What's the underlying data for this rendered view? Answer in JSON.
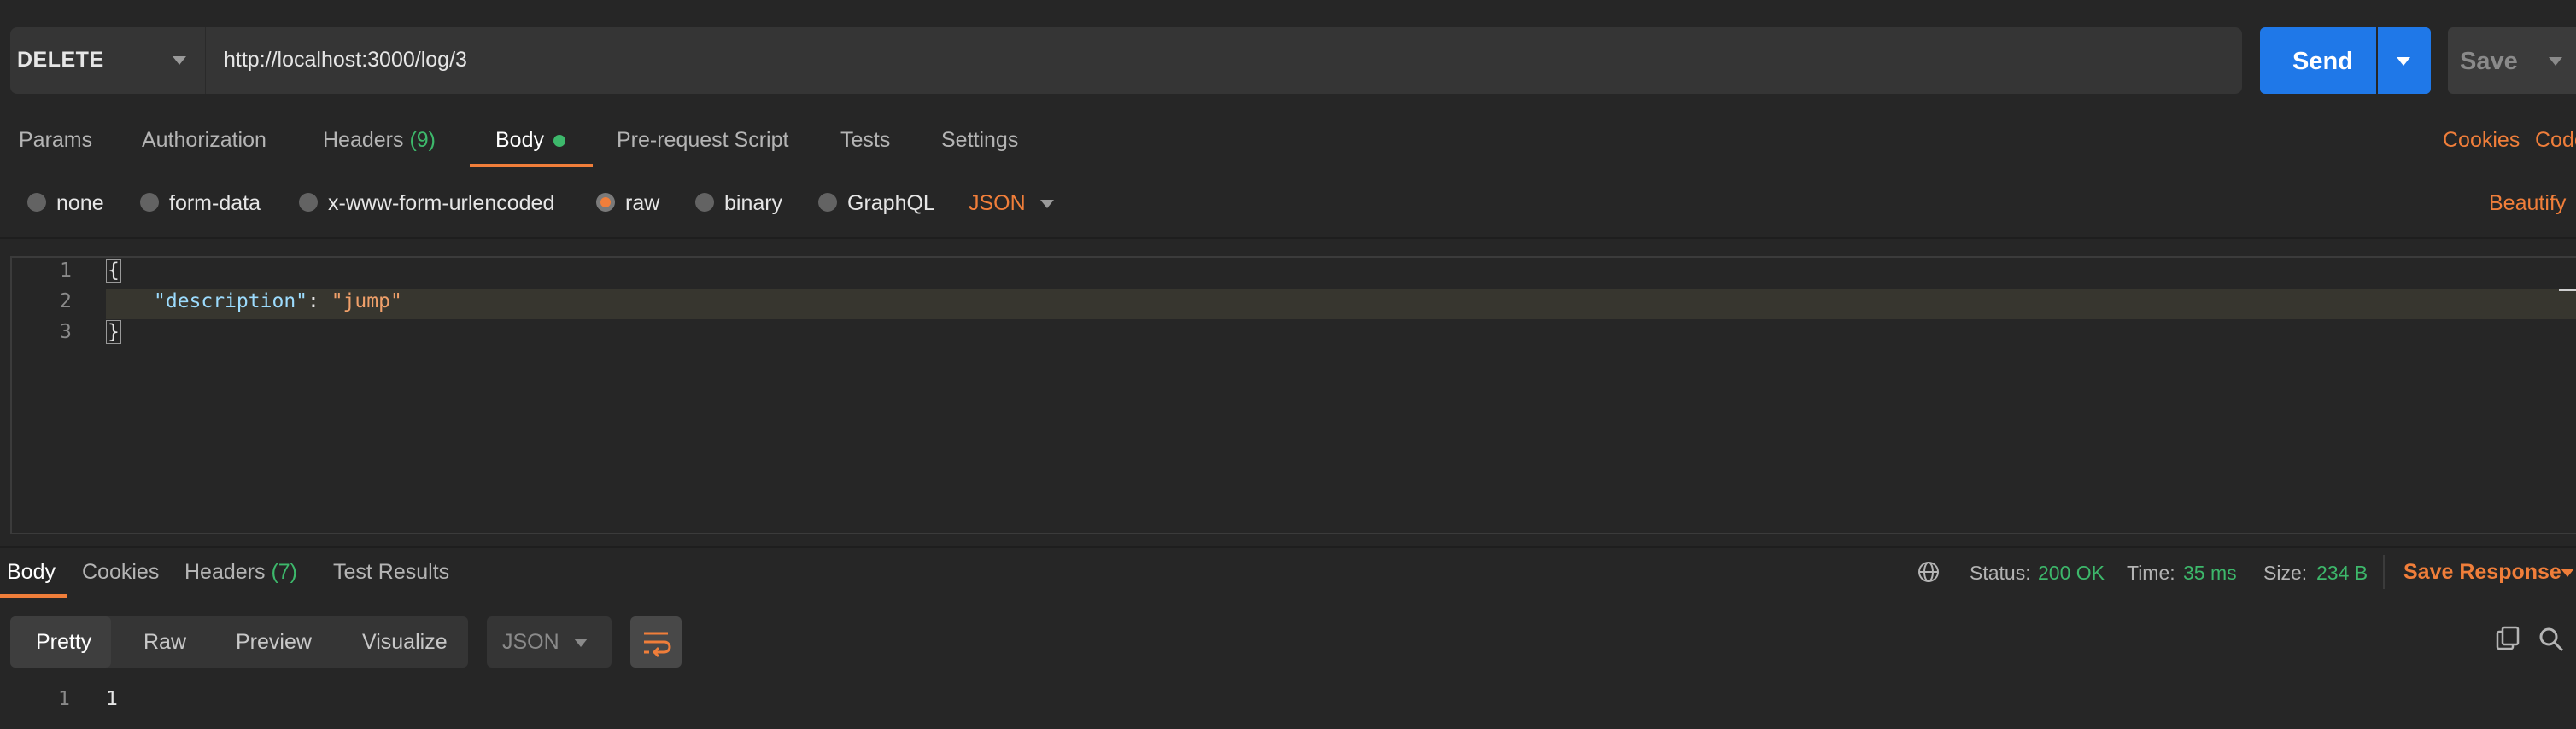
{
  "request": {
    "method": "DELETE",
    "url": "http://localhost:3000/log/3",
    "send_label": "Send",
    "save_label": "Save"
  },
  "request_tabs": [
    {
      "label": "Params"
    },
    {
      "label": "Authorization"
    },
    {
      "label": "Headers",
      "count": "(9)"
    },
    {
      "label": "Body",
      "active": true
    },
    {
      "label": "Pre-request Script"
    },
    {
      "label": "Tests"
    },
    {
      "label": "Settings"
    }
  ],
  "right_links": {
    "cookies": "Cookies",
    "code": "Code"
  },
  "body_types": [
    {
      "label": "none"
    },
    {
      "label": "form-data"
    },
    {
      "label": "x-www-form-urlencoded"
    },
    {
      "label": "raw",
      "selected": true
    },
    {
      "label": "binary"
    },
    {
      "label": "GraphQL"
    }
  ],
  "raw_format": "JSON",
  "beautify_label": "Beautify",
  "editor": {
    "line_numbers": [
      "1",
      "2",
      "3"
    ],
    "open_brace": "{",
    "key": "\"description\"",
    "colon": ": ",
    "value": "\"jump\"",
    "close_brace": "}"
  },
  "response_tabs": [
    {
      "label": "Body",
      "active": true
    },
    {
      "label": "Cookies"
    },
    {
      "label": "Headers",
      "count": "(7)"
    },
    {
      "label": "Test Results"
    }
  ],
  "status": {
    "status_label": "Status:",
    "status_value": "200 OK",
    "time_label": "Time:",
    "time_value": "35 ms",
    "size_label": "Size:",
    "size_value": "234 B"
  },
  "save_response_label": "Save Response",
  "view_modes": [
    "Pretty",
    "Raw",
    "Preview",
    "Visualize"
  ],
  "response_format": "JSON",
  "response_body": {
    "line_number": "1",
    "value": "1"
  },
  "colors": {
    "accent": "#f07e3a",
    "send": "#1f78e8",
    "success": "#3db86b"
  },
  "icons": [
    "chevron-down-icon",
    "globe-icon",
    "wrap-lines-icon",
    "copy-icon",
    "search-icon"
  ]
}
